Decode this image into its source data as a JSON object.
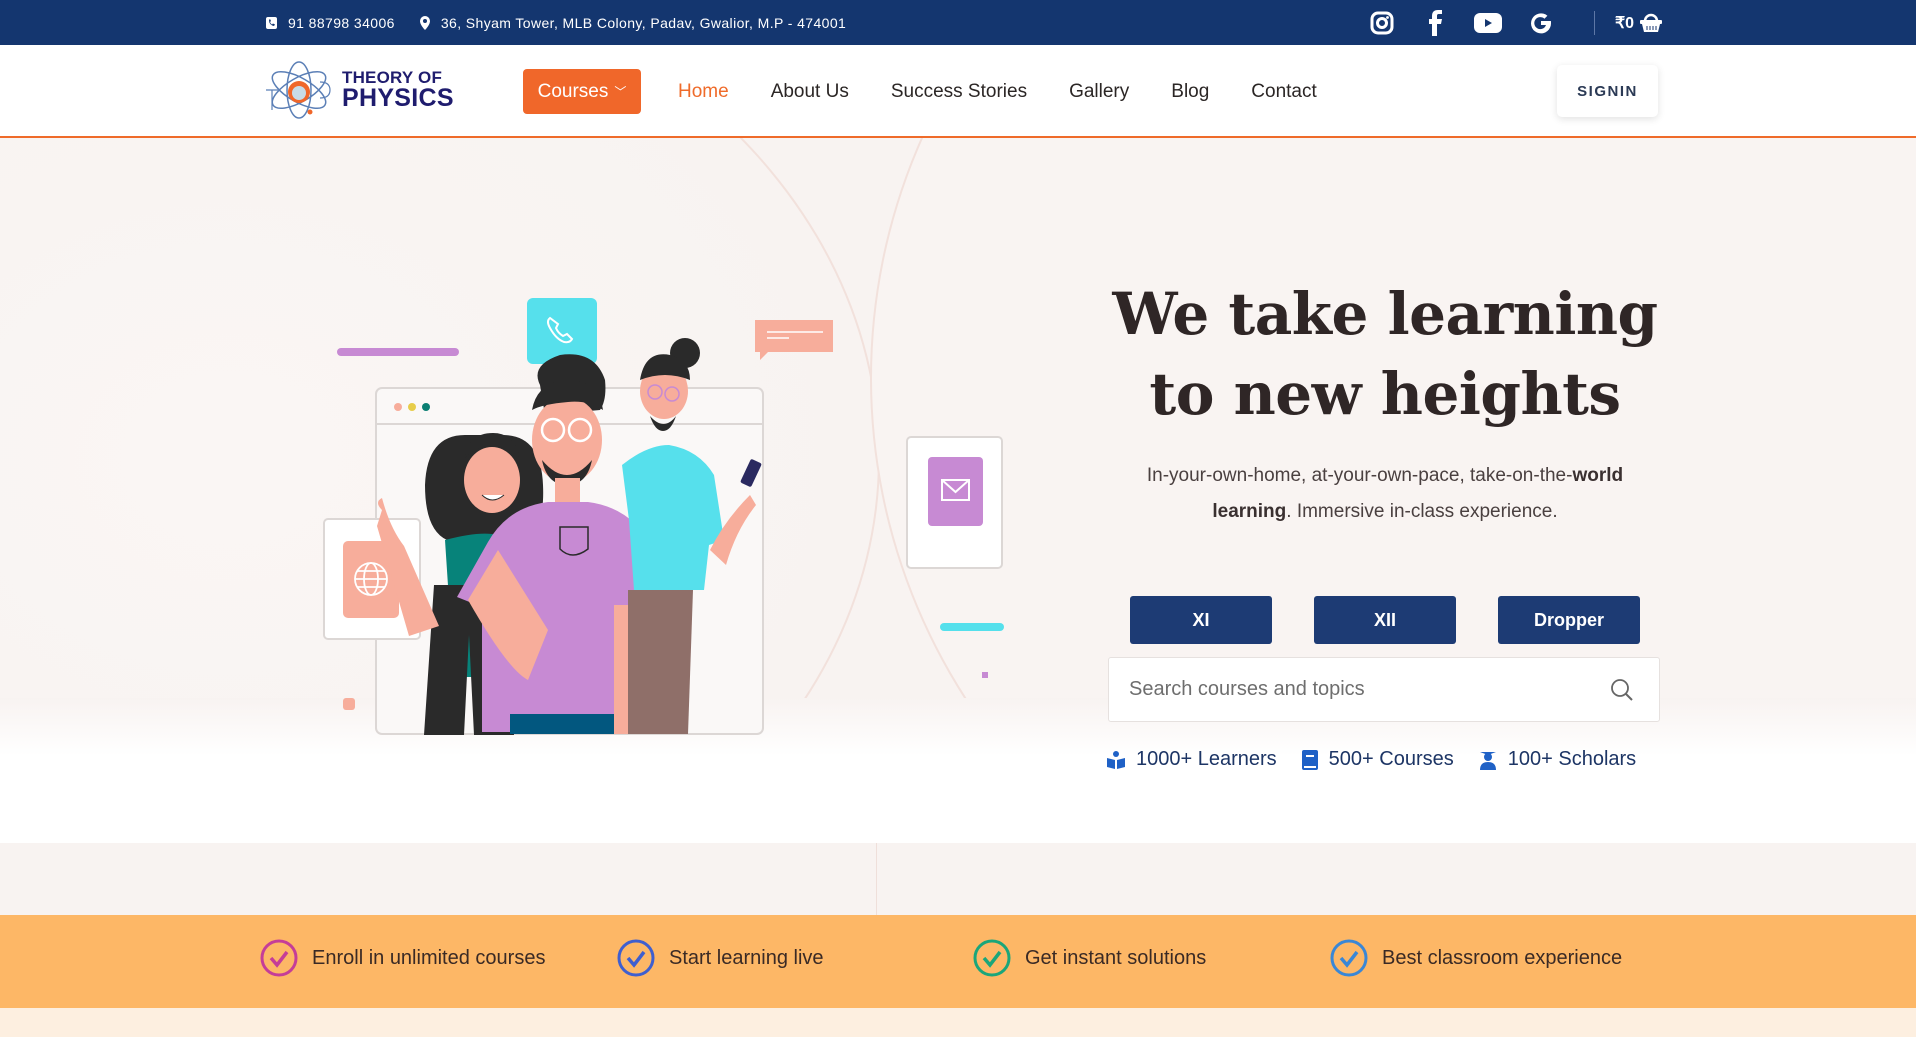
{
  "topbar": {
    "phone": "91 88798 34006",
    "address": "36, Shyam Tower, MLB Colony, Padav, Gwalior, M.P - 474001",
    "socials": [
      "instagram-icon",
      "facebook-icon",
      "youtube-icon",
      "google-icon"
    ],
    "cart_amount": "₹0"
  },
  "nav": {
    "logo": {
      "line1": "THEORY OF",
      "line2": "PHYSICS"
    },
    "courses_label": "Courses",
    "items": [
      {
        "label": "Home",
        "active": true
      },
      {
        "label": "About Us"
      },
      {
        "label": "Success Stories"
      },
      {
        "label": "Gallery"
      },
      {
        "label": "Blog"
      },
      {
        "label": "Contact"
      }
    ],
    "signin_label": "SIGNIN"
  },
  "hero": {
    "title_line1": "We take learning",
    "title_line2": "to new heights",
    "subtitle_part1": "In-your-own-home, at-your-own-pace, take-on-the-",
    "subtitle_bold1": "world learning",
    "subtitle_part2": ". Immersive in-class experience.",
    "levels": [
      "XI",
      "XII",
      "Dropper"
    ],
    "search": {
      "placeholder": "Search courses and topics",
      "value": ""
    },
    "stats": [
      {
        "icon": "reader-icon",
        "label": "1000+ Learners"
      },
      {
        "icon": "book-icon",
        "label": "500+ Courses"
      },
      {
        "icon": "graduate-icon",
        "label": "100+ Scholars"
      }
    ]
  },
  "features": [
    {
      "label": "Enroll in unlimited courses",
      "color": "#c53d98"
    },
    {
      "label": "Start learning live",
      "color": "#3f5fcf"
    },
    {
      "label": "Get instant solutions",
      "color": "#1aa67a"
    },
    {
      "label": "Best classroom experience",
      "color": "#3a87d6"
    }
  ],
  "colors": {
    "topbar": "#14366f",
    "accent": "#ef6b2a",
    "level_button": "#1d3b74",
    "strip": "#fdb766"
  }
}
